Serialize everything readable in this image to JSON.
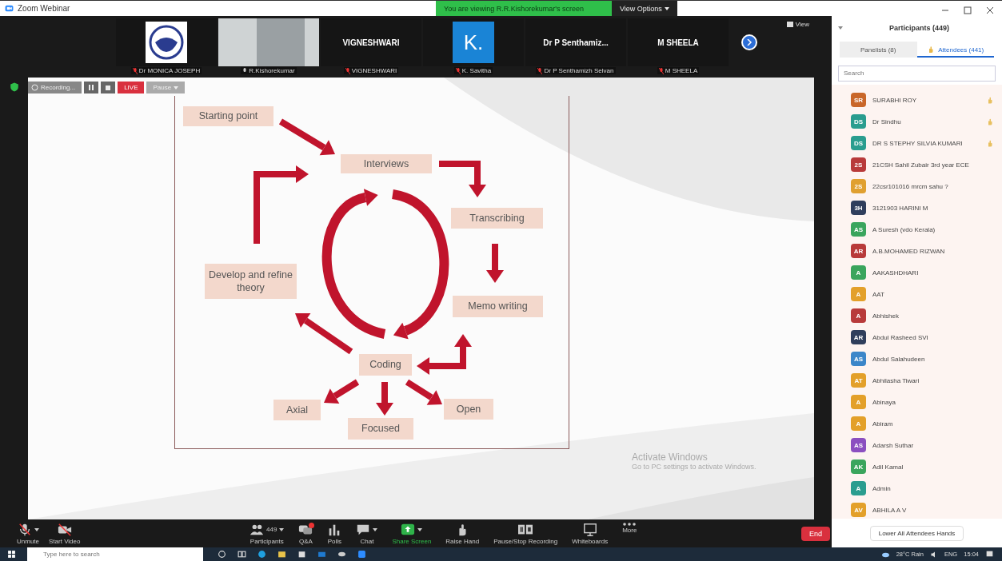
{
  "window": {
    "title": "Zoom Webinar",
    "banner": "You are viewing R.R.Kishorekumar's screen",
    "view_options": "View Options"
  },
  "video_strip": {
    "view": "View",
    "tiles": [
      {
        "kind": "logo",
        "name": "Dr MONICA JOSEPH",
        "muted": true
      },
      {
        "kind": "video",
        "name": "R.Kishorekumar",
        "muted": false
      },
      {
        "kind": "name",
        "display": "VIGNESHWARI",
        "name": "VIGNESHWARI",
        "muted": true
      },
      {
        "kind": "avatar",
        "display": "K.",
        "name": "K. Savitha",
        "muted": true
      },
      {
        "kind": "name",
        "display": "Dr P Senthamiz...",
        "name": "Dr P Senthamizh Selvan",
        "muted": true
      },
      {
        "kind": "name",
        "display": "M SHEELA",
        "name": "M SHEELA",
        "muted": true
      }
    ]
  },
  "recording_bar": {
    "status": "Recording...",
    "live": "LIVE",
    "menu": "Pause"
  },
  "slide": {
    "nodes": [
      {
        "label": "Starting point"
      },
      {
        "label": "Interviews"
      },
      {
        "label": "Transcribing"
      },
      {
        "label": "Develop and refine theory"
      },
      {
        "label": "Memo writing"
      },
      {
        "label": "Coding"
      },
      {
        "label": "Axial"
      },
      {
        "label": "Focused"
      },
      {
        "label": "Open"
      }
    ],
    "activation": {
      "title": "Activate Windows",
      "subtitle": "Go to PC settings to activate Windows."
    }
  },
  "toolbar": {
    "items": [
      {
        "label": "Unmute",
        "caret": true,
        "highlight": false,
        "badge": false
      },
      {
        "label": "Start Video",
        "caret": false,
        "highlight": false,
        "badge": false
      },
      {
        "label": "Participants",
        "count": "449",
        "caret": true,
        "highlight": false,
        "badge": false
      },
      {
        "label": "Q&A",
        "caret": false,
        "highlight": false,
        "badge": true
      },
      {
        "label": "Polls",
        "caret": false,
        "highlight": false,
        "badge": false
      },
      {
        "label": "Chat",
        "caret": true,
        "highlight": false,
        "badge": false
      },
      {
        "label": "Share Screen",
        "caret": true,
        "highlight": true,
        "badge": false
      },
      {
        "label": "Raise Hand",
        "caret": false,
        "highlight": false,
        "badge": false
      },
      {
        "label": "Pause/Stop Recording",
        "caret": false,
        "highlight": false,
        "badge": false
      },
      {
        "label": "Whiteboards",
        "caret": false,
        "highlight": false,
        "badge": false
      },
      {
        "label": "More",
        "caret": false,
        "highlight": false,
        "badge": false
      }
    ],
    "end": "End"
  },
  "panel": {
    "title": "Participants (449)",
    "tabs": [
      {
        "label": "Panelists (8)",
        "selected": false
      },
      {
        "label": "Attendees (441)",
        "selected": true
      }
    ],
    "search": {
      "placeholder": "Search"
    },
    "participants": [
      {
        "initials": "SR",
        "name": "SURABHI ROY",
        "color": "#c9672a",
        "hand_raised": true
      },
      {
        "initials": "DS",
        "name": "Dr Sindhu",
        "color": "#2a9d8f",
        "hand_raised": true
      },
      {
        "initials": "DS",
        "name": "DR S STEPHY SILVIA KUMARI",
        "color": "#2a9d8f",
        "hand_raised": true
      },
      {
        "initials": "2S",
        "name": "21CSH Sahil Zubair 3rd year ECE",
        "color": "#b83a3a",
        "hand_raised": false
      },
      {
        "initials": "2S",
        "name": "22csr101016 mrcm sahu ?",
        "color": "#e0a030",
        "hand_raised": false
      },
      {
        "initials": "3H",
        "name": "3121903 HARINI M",
        "color": "#2f3e5c",
        "hand_raised": false
      },
      {
        "initials": "AS",
        "name": "A Suresh (vdo Kerala)",
        "color": "#3aa55d",
        "hand_raised": false
      },
      {
        "initials": "AR",
        "name": "A.B.MOHAMED RIZWAN",
        "color": "#b83a3a",
        "hand_raised": false
      },
      {
        "initials": "A",
        "name": "AAKASHDHARI",
        "color": "#3aa55d",
        "hand_raised": false
      },
      {
        "initials": "A",
        "name": "AAT",
        "color": "#e3a02a",
        "hand_raised": false
      },
      {
        "initials": "A",
        "name": "Abhishek",
        "color": "#b83a3a",
        "hand_raised": false
      },
      {
        "initials": "AR",
        "name": "Abdul Rasheed SVI",
        "color": "#2f3e5c",
        "hand_raised": false
      },
      {
        "initials": "AS",
        "name": "Abdul Salahudeen",
        "color": "#3b86c9",
        "hand_raised": false
      },
      {
        "initials": "AT",
        "name": "Abhilasha Tiwari",
        "color": "#e3a02a",
        "hand_raised": false
      },
      {
        "initials": "A",
        "name": "Abinaya",
        "color": "#e3a02a",
        "hand_raised": false
      },
      {
        "initials": "A",
        "name": "Abiram",
        "color": "#e3a02a",
        "hand_raised": false
      },
      {
        "initials": "AS",
        "name": "Adarsh Suthar",
        "color": "#8b4fc0",
        "hand_raised": false
      },
      {
        "initials": "AK",
        "name": "Adil Kamal",
        "color": "#3aa55d",
        "hand_raised": false
      },
      {
        "initials": "A",
        "name": "Admin",
        "color": "#2a9d8f",
        "hand_raised": false
      },
      {
        "initials": "AV",
        "name": "ABHILA A V",
        "color": "#e3a02a",
        "hand_raised": false
      }
    ],
    "footer": "Lower All Attendees Hands"
  },
  "taskbar": {
    "search": {
      "placeholder": "Type here to search"
    },
    "weather": "28°C Rain",
    "language": "ENG",
    "time": "15:04"
  }
}
